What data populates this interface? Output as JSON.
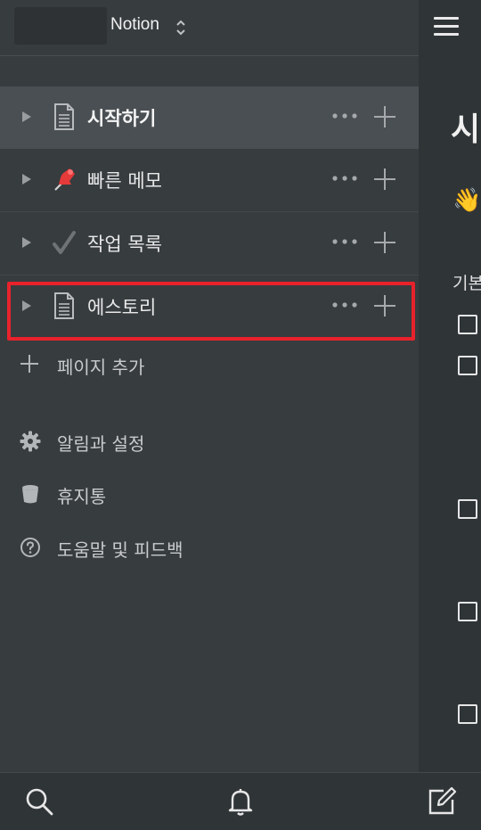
{
  "header": {
    "workspace_name": "Notion",
    "switch_icon": "chevron-up-down-icon",
    "menu_icon": "hamburger-icon"
  },
  "pages": [
    {
      "label": "시작하기",
      "icon": "page-icon",
      "active": true
    },
    {
      "label": "빠른 메모",
      "icon": "pushpin-icon",
      "active": false
    },
    {
      "label": "작업 목록",
      "icon": "checkmark-icon",
      "active": false
    },
    {
      "label": "에스토리",
      "icon": "page-icon",
      "active": false,
      "highlighted": true
    }
  ],
  "add_page_label": "페이지 추가",
  "menu": [
    {
      "label": "알림과 설정",
      "icon": "gear-icon"
    },
    {
      "label": "휴지통",
      "icon": "trash-icon"
    },
    {
      "label": "도움말 및 피드백",
      "icon": "help-circle-icon"
    }
  ],
  "main_peek": {
    "title_fragment": "시",
    "emoji": "👋",
    "subheading_fragment": "기본"
  },
  "bottombar": {
    "search_icon": "search-icon",
    "bell_icon": "bell-icon",
    "compose_icon": "compose-icon"
  },
  "colors": {
    "sidebar_bg": "#373c3f",
    "active_row_bg": "#4a4f53",
    "main_bg": "#2f3437",
    "highlight_border": "#e8222b"
  }
}
